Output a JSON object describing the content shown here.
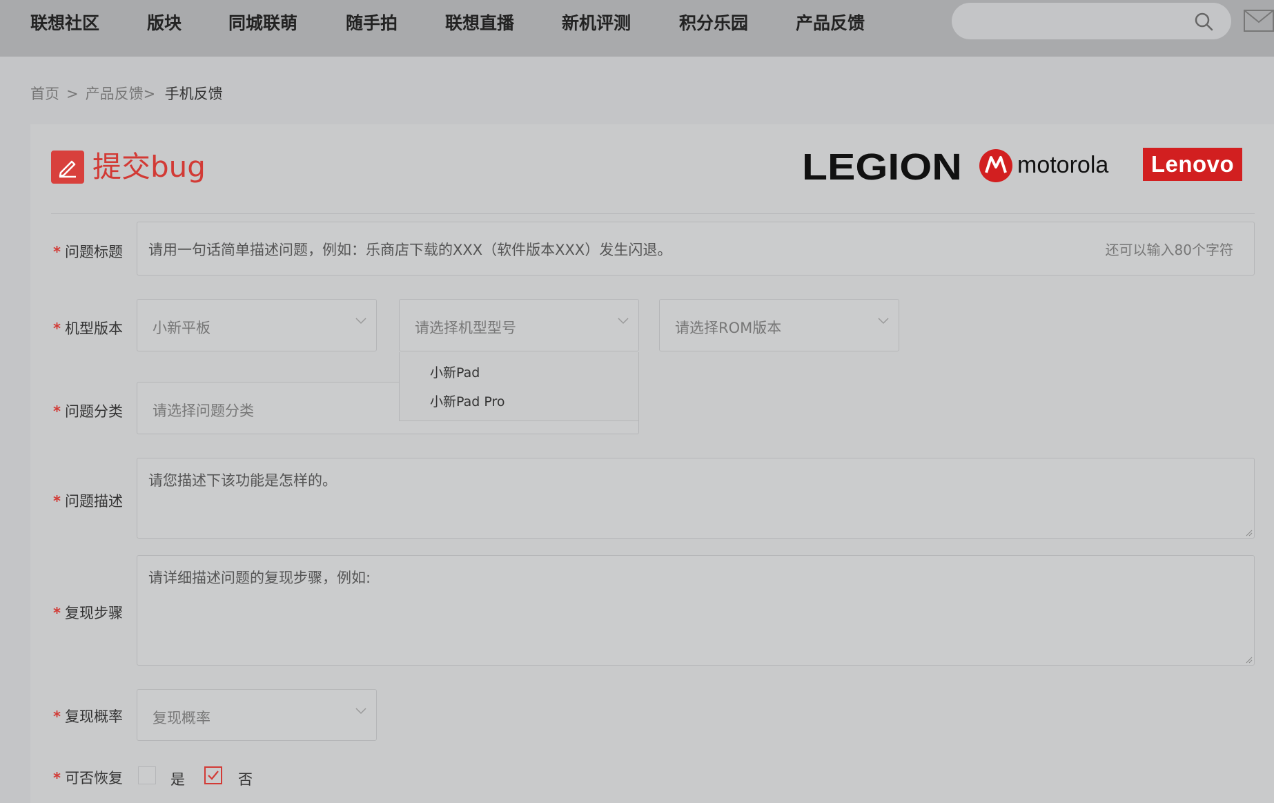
{
  "nav": {
    "items": [
      "联想社区",
      "版块",
      "同城联萌",
      "随手拍",
      "联想直播",
      "新机评测",
      "积分乐园",
      "产品反馈"
    ],
    "search_placeholder": ""
  },
  "breadcrumb": {
    "home": "首页",
    "sep": ">",
    "parent": "产品反馈>",
    "current": "手机反馈"
  },
  "page": {
    "title": "提交bug"
  },
  "brands": {
    "legion": "LEGION",
    "motorola": "motorola",
    "lenovo": "Lenovo"
  },
  "form": {
    "required_mark": "*",
    "title_field": {
      "label": "问题标题",
      "placeholder": "请用一句话简单描述问题，例如：乐商店下载的XXX（软件版本XXX）发生闪退。",
      "counter": "还可以输入80个字符"
    },
    "model_version": {
      "label": "机型版本",
      "series_value": "小新平板",
      "model_placeholder": "请选择机型型号",
      "rom_placeholder": "请选择ROM版本",
      "model_options": [
        "小新Pad",
        "小新Pad Pro"
      ]
    },
    "category": {
      "label": "问题分类",
      "placeholder": "请选择问题分类"
    },
    "description": {
      "label": "问题描述",
      "placeholder": "请您描述下该功能是怎样的。"
    },
    "steps": {
      "label": "复现步骤",
      "placeholder": "请详细描述问题的复现步骤，例如:"
    },
    "probability": {
      "label": "复现概率",
      "placeholder": "复现概率"
    },
    "recoverable": {
      "label": "可否恢复",
      "options": [
        {
          "label": "是",
          "checked": false
        },
        {
          "label": "否",
          "checked": true
        }
      ]
    }
  },
  "colors": {
    "accent": "#d23a35",
    "lenovo_red": "#d21f20",
    "nav_bg": "#a9aaac"
  }
}
